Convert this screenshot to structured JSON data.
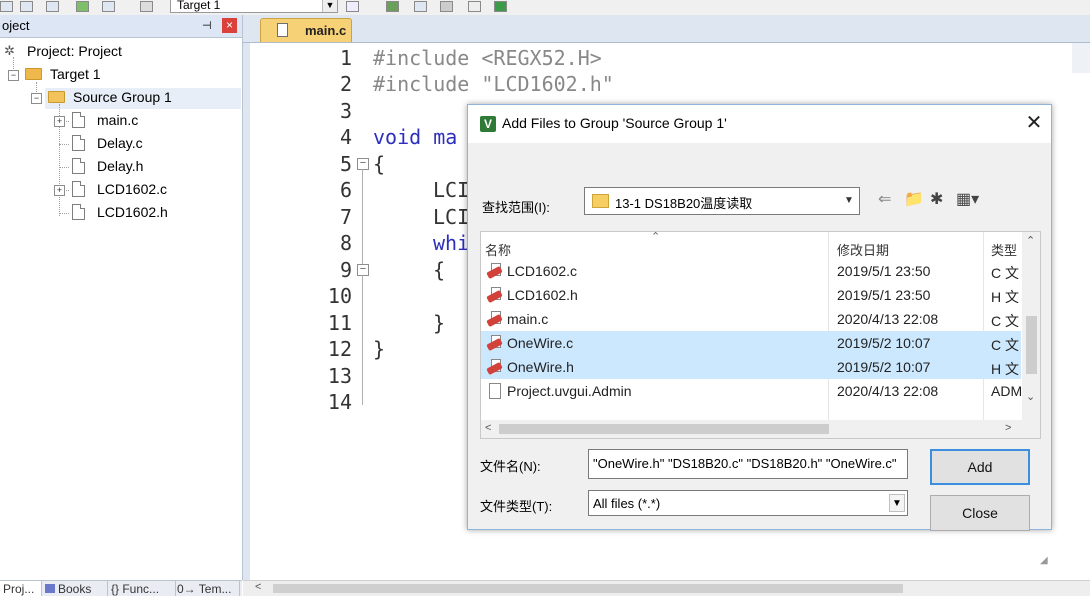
{
  "toolbar": {
    "target_value": "Target 1"
  },
  "project_panel": {
    "title": "oject",
    "pin": "$",
    "close": "×",
    "tree": {
      "project": "Project: Project",
      "target": "Target 1",
      "group": "Source Group 1",
      "files": [
        "main.c",
        "Delay.c",
        "Delay.h",
        "LCD1602.c",
        "LCD1602.h"
      ]
    },
    "tabs": [
      "Proj...",
      "Books",
      "{} Func...",
      "0→ Tem..."
    ]
  },
  "editor": {
    "tab_label": "main.c",
    "line_numbers": [
      "1",
      "2",
      "3",
      "4",
      "5",
      "6",
      "7",
      "8",
      "9",
      "10",
      "11",
      "12",
      "13",
      "14"
    ],
    "lines": {
      "l1": "#include <REGX52.H>",
      "l2": "#include \"LCD1602.h\"",
      "l4": "void ma",
      "l5": "{",
      "l6": "LCI",
      "l7": "LCI",
      "l8": "whi",
      "l9": "{",
      "l11": "}",
      "l12": "}"
    }
  },
  "dialog": {
    "title": "Add Files to Group 'Source Group 1'",
    "close": "✕",
    "look_in_label": "查找范围(I):",
    "look_in_value": "13-1 DS18B20温度读取",
    "columns": {
      "name": "名称",
      "date": "修改日期",
      "type": "类型"
    },
    "files": [
      {
        "name": "LCD1602.c",
        "date": "2019/5/1 23:50",
        "type": "C 文"
      },
      {
        "name": "LCD1602.h",
        "date": "2019/5/1 23:50",
        "type": "H 文"
      },
      {
        "name": "main.c",
        "date": "2020/4/13 22:08",
        "type": "C 文"
      },
      {
        "name": "OneWire.c",
        "date": "2019/5/2 10:07",
        "type": "C 文",
        "selected": true
      },
      {
        "name": "OneWire.h",
        "date": "2019/5/2 10:07",
        "type": "H 文",
        "selected": true
      },
      {
        "name": "Project.uvgui.Admin",
        "date": "2020/4/13 22:08",
        "type": "ADM"
      }
    ],
    "filename_label": "文件名(N):",
    "filename_value": "\"OneWire.h\" \"DS18B20.c\" \"DS18B20.h\" \"OneWire.c\"",
    "filetype_label": "文件类型(T):",
    "filetype_value": "All files (*.*)",
    "add_button": "Add",
    "close_button": "Close"
  },
  "colors": {
    "selection": "#cce8ff",
    "editor_tab": "#f7d175",
    "keyword": "#2d2fbd",
    "preprocessor": "#888888"
  }
}
